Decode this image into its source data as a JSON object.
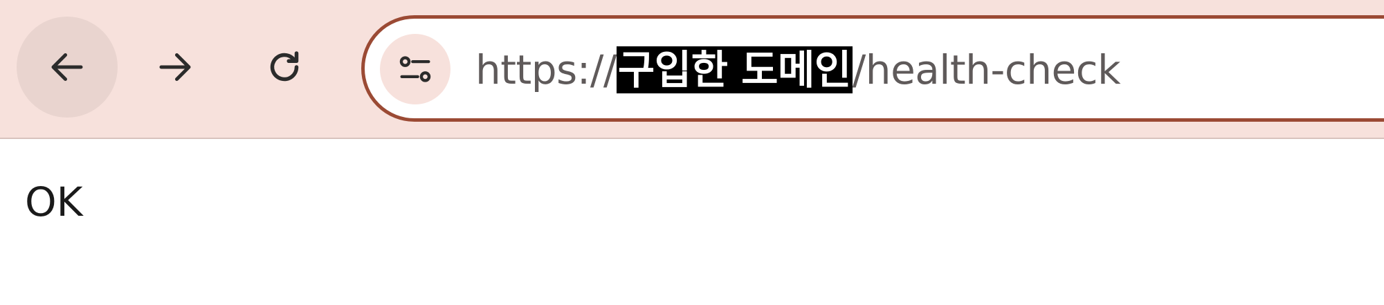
{
  "toolbar": {
    "back_icon": "arrow-left-icon",
    "forward_icon": "arrow-right-icon",
    "reload_icon": "reload-icon",
    "site_info_icon": "tune-icon"
  },
  "omnibox": {
    "url_prefix": "https://",
    "url_selected": "구입한 도메인",
    "url_suffix": "/health-check"
  },
  "page": {
    "body_text": "OK"
  },
  "colors": {
    "toolbar_bg": "#f7e1dc",
    "omnibox_border": "#9b4a34",
    "selection_bg": "#000000",
    "selection_text": "#ffffff"
  }
}
